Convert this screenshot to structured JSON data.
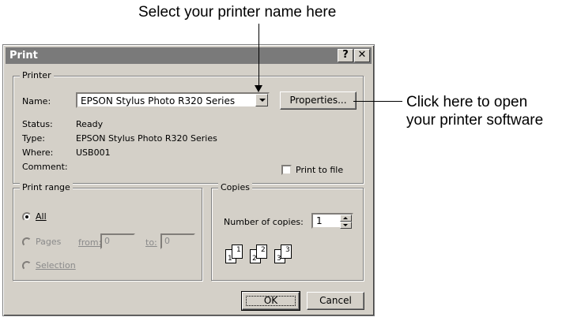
{
  "callouts": {
    "top": "Select your printer name here",
    "right_line1": "Click here to open",
    "right_line2": "your printer software"
  },
  "dialog": {
    "title": "Print",
    "help_button": "?",
    "close_button": "✕",
    "printer_group": {
      "label": "Printer",
      "name_label": "Name:",
      "name_value": "EPSON Stylus Photo R320 Series",
      "properties_button": "Properties...",
      "status_label": "Status:",
      "status_value": "Ready",
      "type_label": "Type:",
      "type_value": "EPSON Stylus Photo R320 Series",
      "where_label": "Where:",
      "where_value": "USB001",
      "comment_label": "Comment:",
      "comment_value": "",
      "print_to_file_label": "Print to file"
    },
    "print_range": {
      "label": "Print range",
      "all_label": "All",
      "pages_label": "Pages",
      "from_label": "from:",
      "from_value": "0",
      "to_label": "to:",
      "to_value": "0",
      "selection_label": "Selection",
      "selected": "All"
    },
    "copies": {
      "label": "Copies",
      "number_label": "Number of copies:",
      "number_value": "1",
      "collate_pages": [
        "1",
        "1",
        "2",
        "2",
        "3",
        "3"
      ]
    },
    "ok_button": "OK",
    "cancel_button": "Cancel"
  },
  "colors": {
    "dialog_bg": "#d4d0c8",
    "titlebar": "#7a7a7a"
  }
}
